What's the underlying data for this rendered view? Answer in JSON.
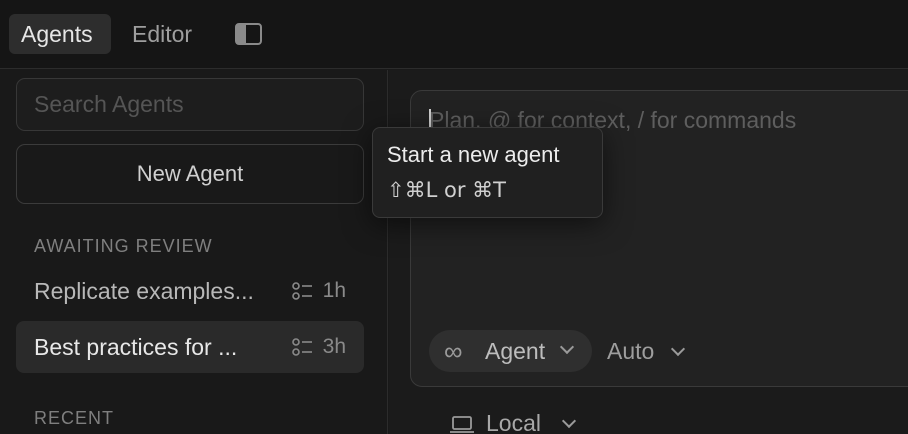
{
  "topbar": {
    "tabs": [
      {
        "label": "Agents",
        "active": true
      },
      {
        "label": "Editor",
        "active": false
      }
    ],
    "layout_toggle_icon": "sidebar-layout-icon"
  },
  "sidebar": {
    "search_placeholder": "Search Agents",
    "new_agent_label": "New Agent",
    "sections": [
      {
        "title": "AWAITING REVIEW",
        "items": [
          {
            "label": "Replicate examples...",
            "icon": "todo-list-icon",
            "age": "1h",
            "selected": false
          },
          {
            "label": "Best practices for ...",
            "icon": "todo-list-icon",
            "age": "3h",
            "selected": true
          }
        ]
      },
      {
        "title": "RECENT",
        "items": []
      }
    ]
  },
  "composer": {
    "placeholder": "Plan, @ for context, / for commands",
    "mode_label": "Agent",
    "mode_icon": "infinity-icon",
    "model_label": "Auto",
    "environment_label": "Local",
    "environment_icon": "laptop-icon"
  },
  "tooltip": {
    "title": "Start a new agent",
    "shortcut": "⇧⌘L or ⌘T"
  },
  "colors": {
    "background": "#191919",
    "panel": "#222222",
    "selected": "#2a2a2a",
    "text": "#d6d6d6"
  }
}
